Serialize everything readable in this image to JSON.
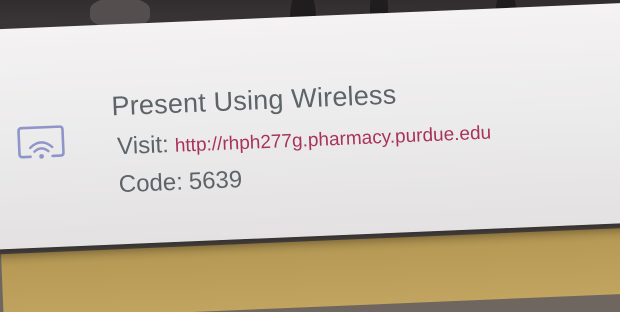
{
  "instruction": {
    "title": "Present Using Wireless",
    "visit_label": "Visit:",
    "url": "http://rhph277g.pharmacy.purdue.edu",
    "code_label": "Code:",
    "code": "5639"
  },
  "icons": {
    "wireless": "wireless-display-icon"
  },
  "colors": {
    "panel": "#ecebec",
    "text": "#5d6468",
    "url": "#a8325a",
    "icon": "#8f95c8"
  }
}
